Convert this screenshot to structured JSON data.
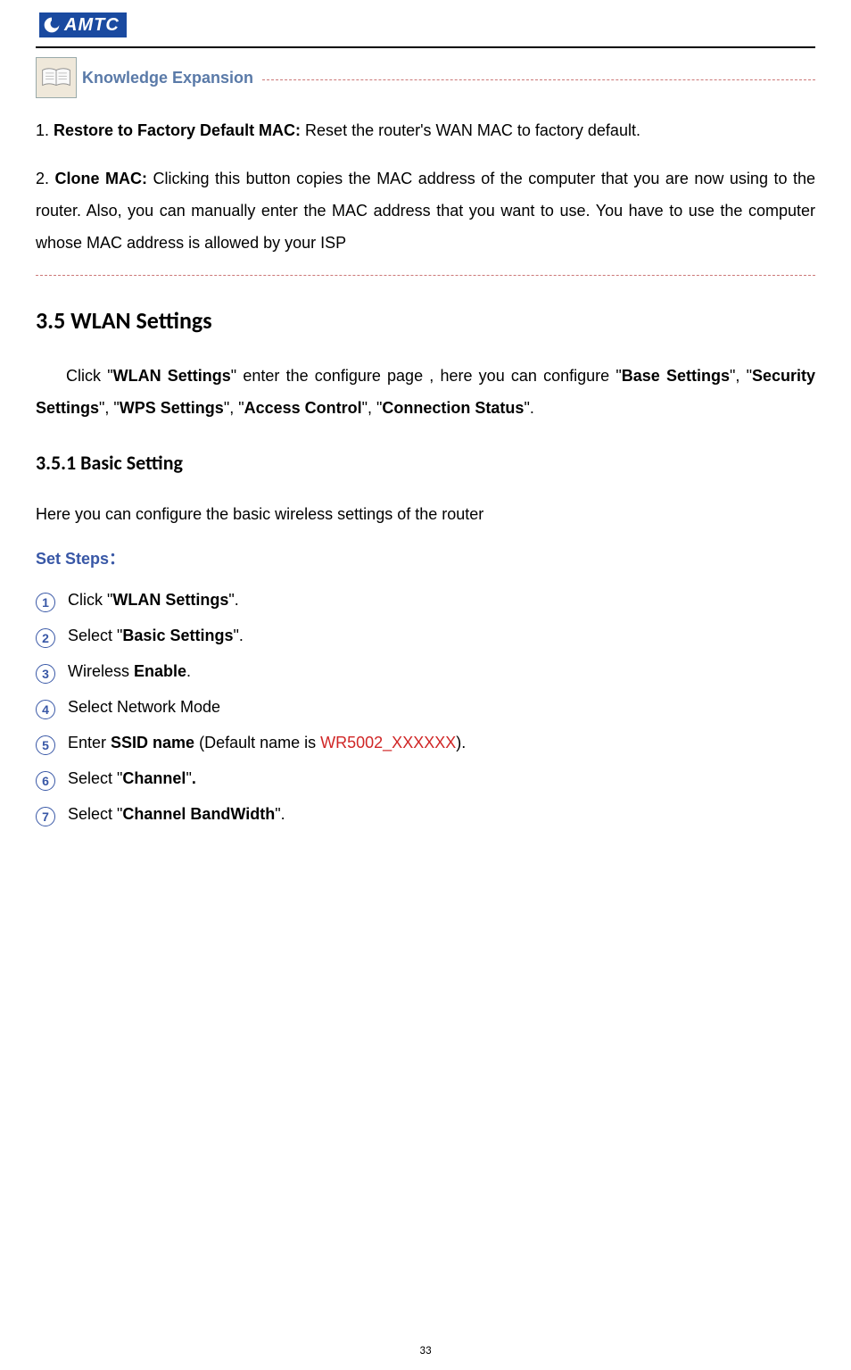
{
  "logo": {
    "text": "AMTC"
  },
  "knowledge_expansion": {
    "label": "Knowledge Expansion",
    "item1": {
      "prefix": "1. ",
      "bold": "Restore to Factory Default MAC:",
      "rest": " Reset the router's WAN MAC to factory default."
    },
    "item2": {
      "prefix": "2. ",
      "bold": "Clone MAC:",
      "rest": " Clicking this button copies the MAC address of the computer that you are now using to the router. Also, you can manually enter the MAC address that you want to use. You have to use the computer whose MAC address is allowed by your ISP"
    }
  },
  "section_3_5": {
    "heading": "3.5 WLAN Settings",
    "intro": {
      "p1a": "Click \"",
      "p1b": "WLAN Settings",
      "p1c": "\" enter the configure page , here you can configure \"",
      "p1d": "Base Settings",
      "p1e": "\", \"",
      "p1f": "Security Settings",
      "p1g": "\",  \"",
      "p1h": "WPS Settings",
      "p1i": "\", \"",
      "p1j": "Access Control",
      "p1k": "\", \"",
      "p1l": "Connection Status",
      "p1m": "\"."
    }
  },
  "section_3_5_1": {
    "heading": "3.5.1 Basic Setting",
    "intro": "Here you can configure the basic wireless settings of the router",
    "set_steps_label": "Set Steps：",
    "steps": {
      "s1a": "Click \"",
      "s1b": "WLAN Settings",
      "s1c": "\".",
      "s2a": "Select \"",
      "s2b": "Basic Settings",
      "s2c": "\".",
      "s3a": "Wireless ",
      "s3b": "Enable",
      "s3c": ".",
      "s4": "Select Network Mode",
      "s5a": "Enter ",
      "s5b": "SSID name",
      "s5c": " (Default name is ",
      "s5d": "WR5002_XXXXXX",
      "s5e": ").",
      "s6a": "Select \"",
      "s6b": "Channel",
      "s6c": "\"",
      "s6d": ".",
      "s7a": "Select \"",
      "s7b": "Channel BandWidth",
      "s7c": "\"."
    }
  },
  "page_number": "33"
}
